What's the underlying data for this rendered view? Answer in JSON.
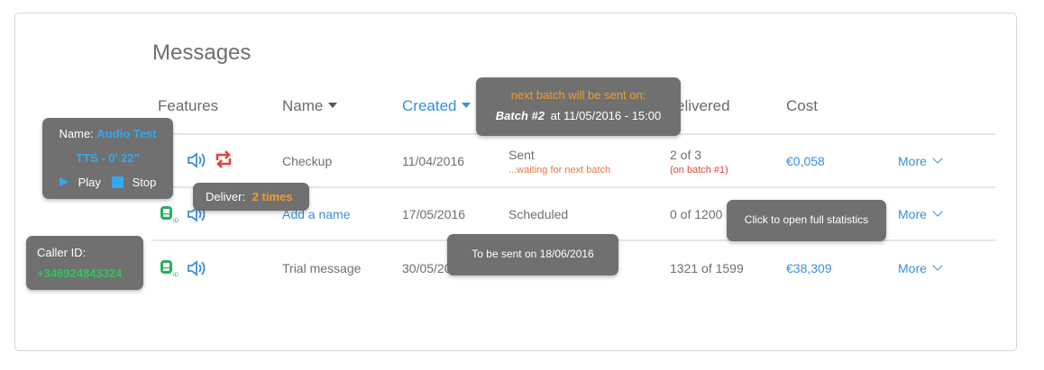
{
  "title": "Messages",
  "headers": {
    "features": "Features",
    "name": "Name",
    "created": "Created",
    "delivered": "Delivered",
    "delivered_visible": "elivered",
    "cost": "Cost"
  },
  "rows": [
    {
      "name": "Checkup",
      "created": "11/04/2016",
      "status": "Sent",
      "status_sub": "...waiting for next batch",
      "delivered": "2 of 3",
      "delivered_sub": "(on batch #1)",
      "cost": "€0,058",
      "more": "More"
    },
    {
      "name": "Add a name",
      "created": "17/05/2016",
      "status": "Scheduled",
      "delivered": "0 of 1200",
      "more": "More"
    },
    {
      "name": "Trial message",
      "created": "30/05/20",
      "delivered": "1321 of 1599",
      "cost": "€38,309",
      "more": "More"
    }
  ],
  "tooltips": {
    "audio": {
      "name_label": "Name:",
      "name_value": "Audio Test",
      "tts": "TTS - 0' 22\"",
      "play": "Play",
      "stop": "Stop"
    },
    "deliver": {
      "label": "Deliver:",
      "value": "2 times"
    },
    "batch": {
      "line1": "next batch will be sent on:",
      "batch_label": "Batch #2",
      "batch_rest": "at 11/05/2016 - 15:00"
    },
    "scheduled": {
      "text": "To be sent on 18/06/2016"
    },
    "stats": {
      "text": "Click to open full statistics"
    },
    "caller": {
      "label": "Caller ID:",
      "value": "+346924843324"
    }
  },
  "colors": {
    "accent_blue": "#3a8fdc",
    "caller_green": "#27ae60",
    "repeat_red": "#e0443c",
    "tooltip_bg": "#707070",
    "orange": "#f39c2a"
  },
  "icons": [
    "caller-id-icon",
    "audio-speaker-icon",
    "repeat-icon",
    "play-icon",
    "stop-icon",
    "chevron-down-icon"
  ]
}
